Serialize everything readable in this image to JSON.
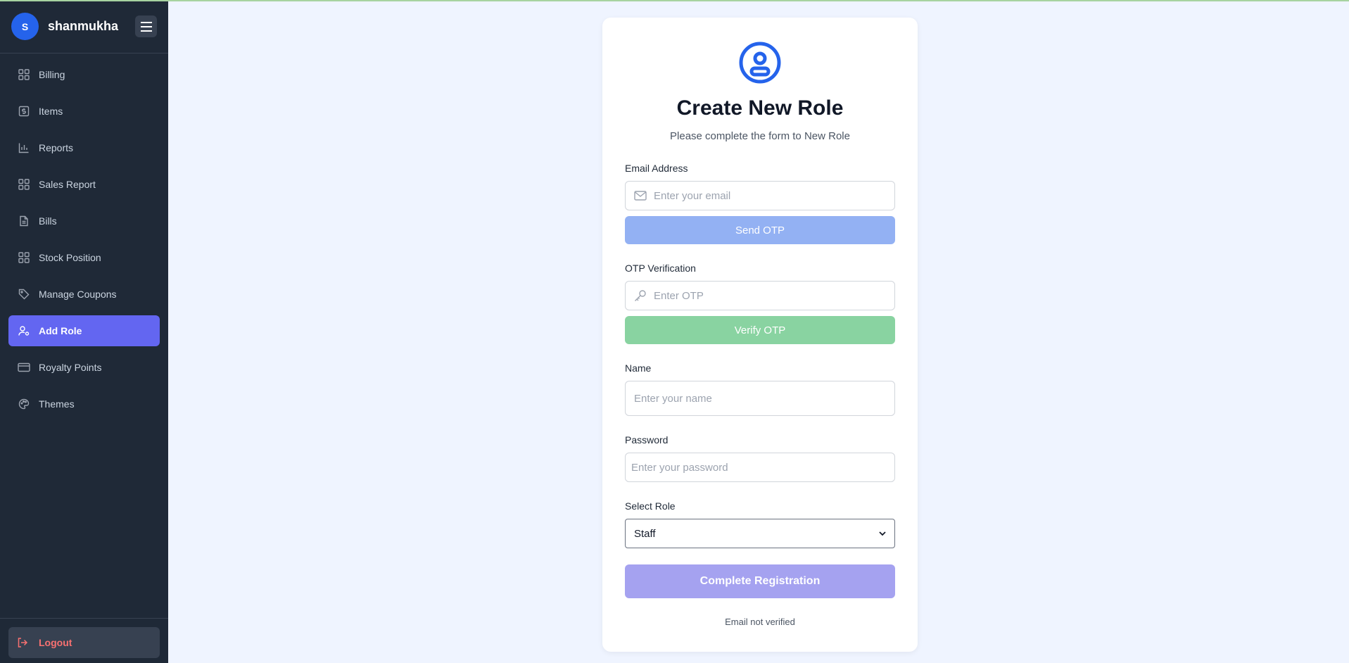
{
  "user": {
    "initial": "S",
    "name": "shanmukha"
  },
  "sidebar": {
    "items": [
      {
        "label": "Billing",
        "icon": "grid-icon"
      },
      {
        "label": "Items",
        "icon": "dollar-square-icon"
      },
      {
        "label": "Reports",
        "icon": "bar-chart-icon"
      },
      {
        "label": "Sales Report",
        "icon": "grid-icon"
      },
      {
        "label": "Bills",
        "icon": "document-icon"
      },
      {
        "label": "Stock Position",
        "icon": "grid-icon"
      },
      {
        "label": "Manage Coupons",
        "icon": "tag-icon"
      },
      {
        "label": "Add Role",
        "icon": "user-add-icon",
        "active": true
      },
      {
        "label": "Royalty Points",
        "icon": "card-icon"
      },
      {
        "label": "Themes",
        "icon": "palette-icon"
      }
    ],
    "logout_label": "Logout"
  },
  "form": {
    "title": "Create New Role",
    "subtitle": "Please complete the form to New Role",
    "email_label": "Email Address",
    "email_placeholder": "Enter your email",
    "send_otp": "Send OTP",
    "otp_label": "OTP Verification",
    "otp_placeholder": "Enter OTP",
    "verify_otp": "Verify OTP",
    "name_label": "Name",
    "name_placeholder": "Enter your name",
    "password_label": "Password",
    "password_placeholder": "Enter your password",
    "role_label": "Select Role",
    "role_value": "Staff",
    "submit": "Complete Registration",
    "status": "Email not verified"
  },
  "colors": {
    "sidebar_bg": "#1f2937",
    "active_item": "#6366f1",
    "send_otp_bg": "#93b1f3",
    "verify_otp_bg": "#89d3a1",
    "submit_bg": "#a5a2f0",
    "logout_text": "#f87171"
  }
}
